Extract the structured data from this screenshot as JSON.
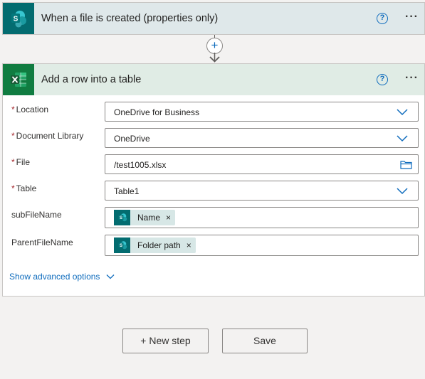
{
  "trigger": {
    "title": "When a file is created (properties only)",
    "icon": "sharepoint-icon",
    "help_glyph": "?",
    "more_glyph": "···"
  },
  "connector": {
    "add_glyph": "+"
  },
  "action": {
    "title": "Add a row into a table",
    "icon": "excel-icon",
    "help_glyph": "?",
    "more_glyph": "···",
    "fields": {
      "location": {
        "label": "Location",
        "required": "*",
        "value": "OneDrive for Business"
      },
      "document_library": {
        "label": "Document Library",
        "required": "*",
        "value": "OneDrive"
      },
      "file": {
        "label": "File",
        "required": "*",
        "value": "/test1005.xlsx"
      },
      "table": {
        "label": "Table",
        "required": "*",
        "value": "Table1"
      },
      "sub_file_name": {
        "label": "subFileName",
        "token": "Name",
        "remove": "×"
      },
      "parent_file_name": {
        "label": "ParentFileName",
        "token": "Folder path",
        "remove": "×"
      }
    },
    "advanced_options": "Show advanced options"
  },
  "footer": {
    "new_step": "+ New step",
    "save": "Save"
  },
  "colors": {
    "sharepoint": "#036c70",
    "excel": "#107c41",
    "link": "#0f6cbd",
    "required": "#a4262c"
  }
}
